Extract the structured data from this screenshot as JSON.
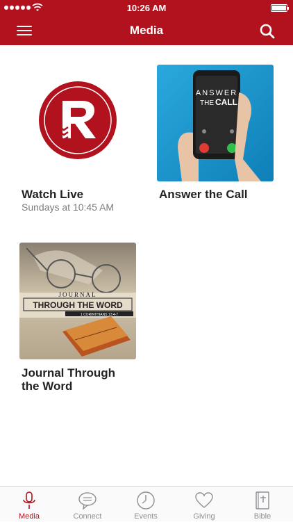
{
  "status_bar": {
    "time": "10:26 AM"
  },
  "nav": {
    "title": "Media"
  },
  "media_items": [
    {
      "title": "Watch Live",
      "subtitle": "Sundays at 10:45 AM"
    },
    {
      "title": "Answer the Call",
      "thumb_text": [
        "ANSWER",
        "THE",
        "CALL"
      ]
    },
    {
      "title_line1": "Journal Through",
      "title_line2": "the Word",
      "thumb_text": [
        "JOURNAL",
        "THROUGH THE WORD",
        "1 CORINTHIANS 13:4-7"
      ]
    }
  ],
  "tabs": [
    {
      "label": "Media",
      "icon": "microphone-icon",
      "active": true
    },
    {
      "label": "Connect",
      "icon": "chat-bubble-icon",
      "active": false
    },
    {
      "label": "Events",
      "icon": "clock-icon",
      "active": false
    },
    {
      "label": "Giving",
      "icon": "heart-icon",
      "active": false
    },
    {
      "label": "Bible",
      "icon": "bible-icon",
      "active": false
    }
  ],
  "colors": {
    "brand": "#b2111e",
    "inactive_tab": "#8e8e93"
  }
}
